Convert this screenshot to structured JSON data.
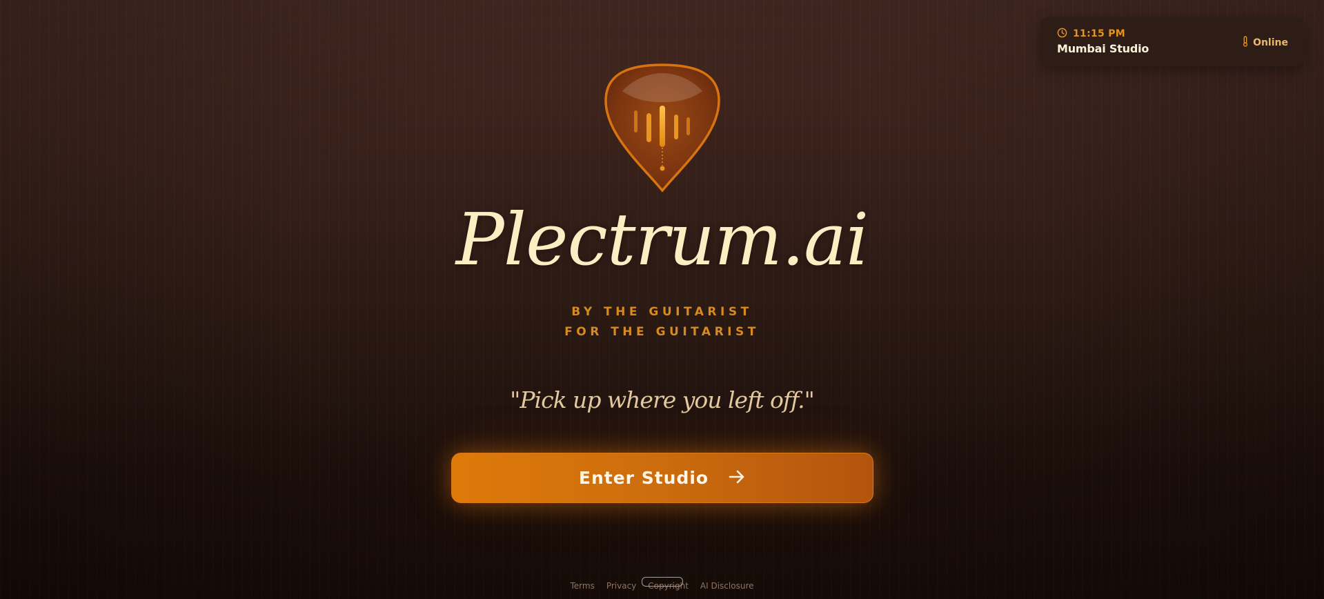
{
  "status": {
    "time": "11:15 PM",
    "studio": "Mumbai Studio",
    "connection": "Online",
    "icons": {
      "time": "clock-icon",
      "connection": "thermometer-icon"
    }
  },
  "brand": {
    "logo_icon": "guitar-pick-waveform-icon",
    "title": "Plectrum.ai",
    "tagline_line1": "BY THE GUITARIST",
    "tagline_line2": "FOR THE GUITARIST",
    "quote": "\"Pick up where you left off.\""
  },
  "cta": {
    "label": "Enter Studio",
    "icon": "arrow-right-icon"
  },
  "footer": {
    "links": [
      "Terms",
      "Privacy",
      "Copyright",
      "AI Disclosure"
    ]
  },
  "colors": {
    "accent": "#e07a0e",
    "accent_dark": "#b3540e",
    "gold": "#d68a1f",
    "cream": "#fdedc3",
    "background_top": "#452922",
    "background_bottom": "#170c08"
  }
}
